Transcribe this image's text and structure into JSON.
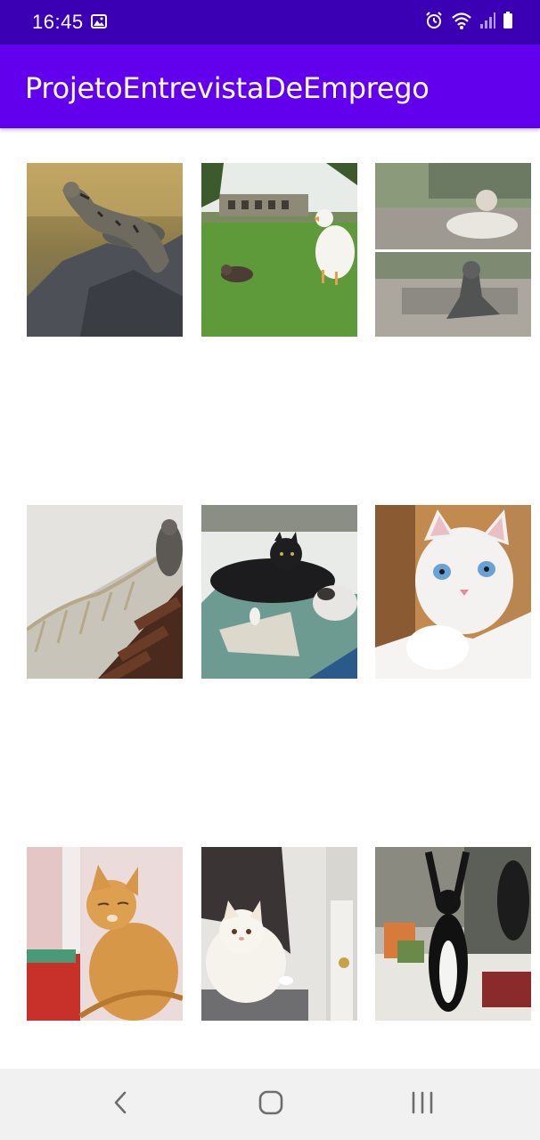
{
  "status_bar": {
    "time": "16:45",
    "icons_left": [
      "gallery-icon"
    ],
    "icons_right": [
      "alarm-icon",
      "wifi-icon",
      "signal-icon",
      "battery-icon"
    ],
    "color": "#3b00b3"
  },
  "app_bar": {
    "title": "ProjetoEntrevistaDeEmprego",
    "color": "#6200ee"
  },
  "grid": {
    "columns": 3,
    "images": [
      {
        "subject": "striped wild cat on rocks"
      },
      {
        "subject": "white duck and kitten on grass"
      },
      {
        "subject": "cat statue on street bench collage"
      },
      {
        "subject": "cats on rope bridge"
      },
      {
        "subject": "black cat with calico cat on blanket"
      },
      {
        "subject": "white cat with blue eyes in box"
      },
      {
        "subject": "orange tabby cat"
      },
      {
        "subject": "white fluffy cat by door"
      },
      {
        "subject": "black and white cat standing at mirror"
      }
    ]
  },
  "nav_bar": {
    "buttons": [
      "back-icon",
      "home-icon",
      "recents-icon"
    ]
  }
}
